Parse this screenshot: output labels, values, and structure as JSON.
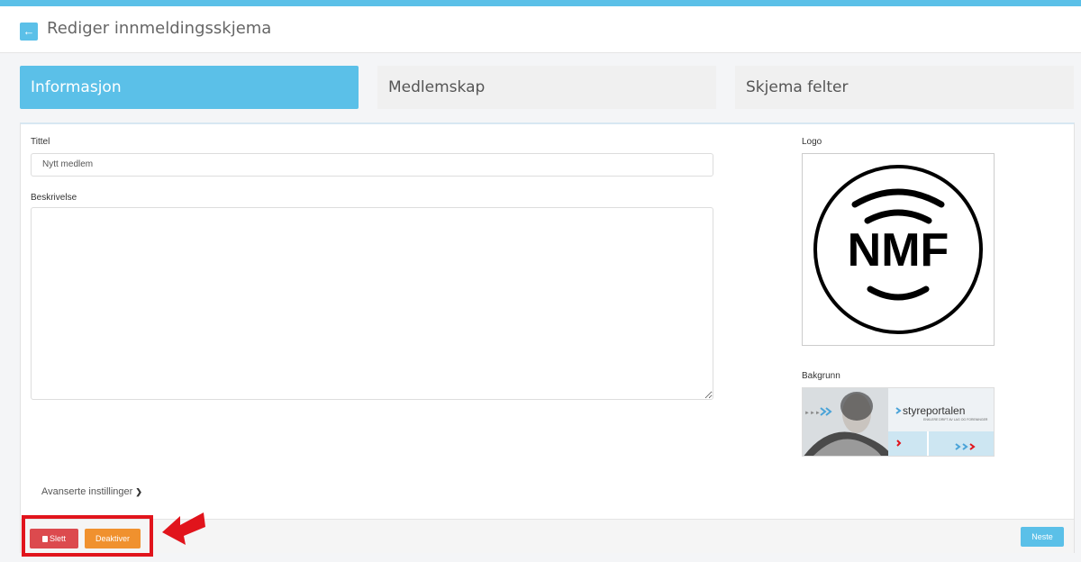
{
  "header": {
    "back_icon": "arrow-left-icon",
    "title": "Rediger innmeldingsskjema"
  },
  "tabs": [
    {
      "label": "Informasjon",
      "active": true
    },
    {
      "label": "Medlemskap",
      "active": false
    },
    {
      "label": "Skjema felter",
      "active": false
    }
  ],
  "form": {
    "title_label": "Tittel",
    "title_value": "Nytt medlem",
    "description_label": "Beskrivelse",
    "description_value": "",
    "logo_label": "Logo",
    "logo_text": "NMF",
    "background_label": "Bakgrunn",
    "background_brand": "styreportalen",
    "background_tagline": "ENKLERE DRIFT AV LAG OG FORENINGER",
    "advanced_label": "Avanserte instillinger"
  },
  "footer": {
    "delete_label": "Slett",
    "delete_icon": "trash-icon",
    "deactivate_label": "Deaktiver",
    "next_label": "Neste"
  },
  "colors": {
    "accent": "#5bc0e8",
    "danger": "#dc4a4e",
    "warning": "#f0912e",
    "annotation": "#e1141c"
  }
}
